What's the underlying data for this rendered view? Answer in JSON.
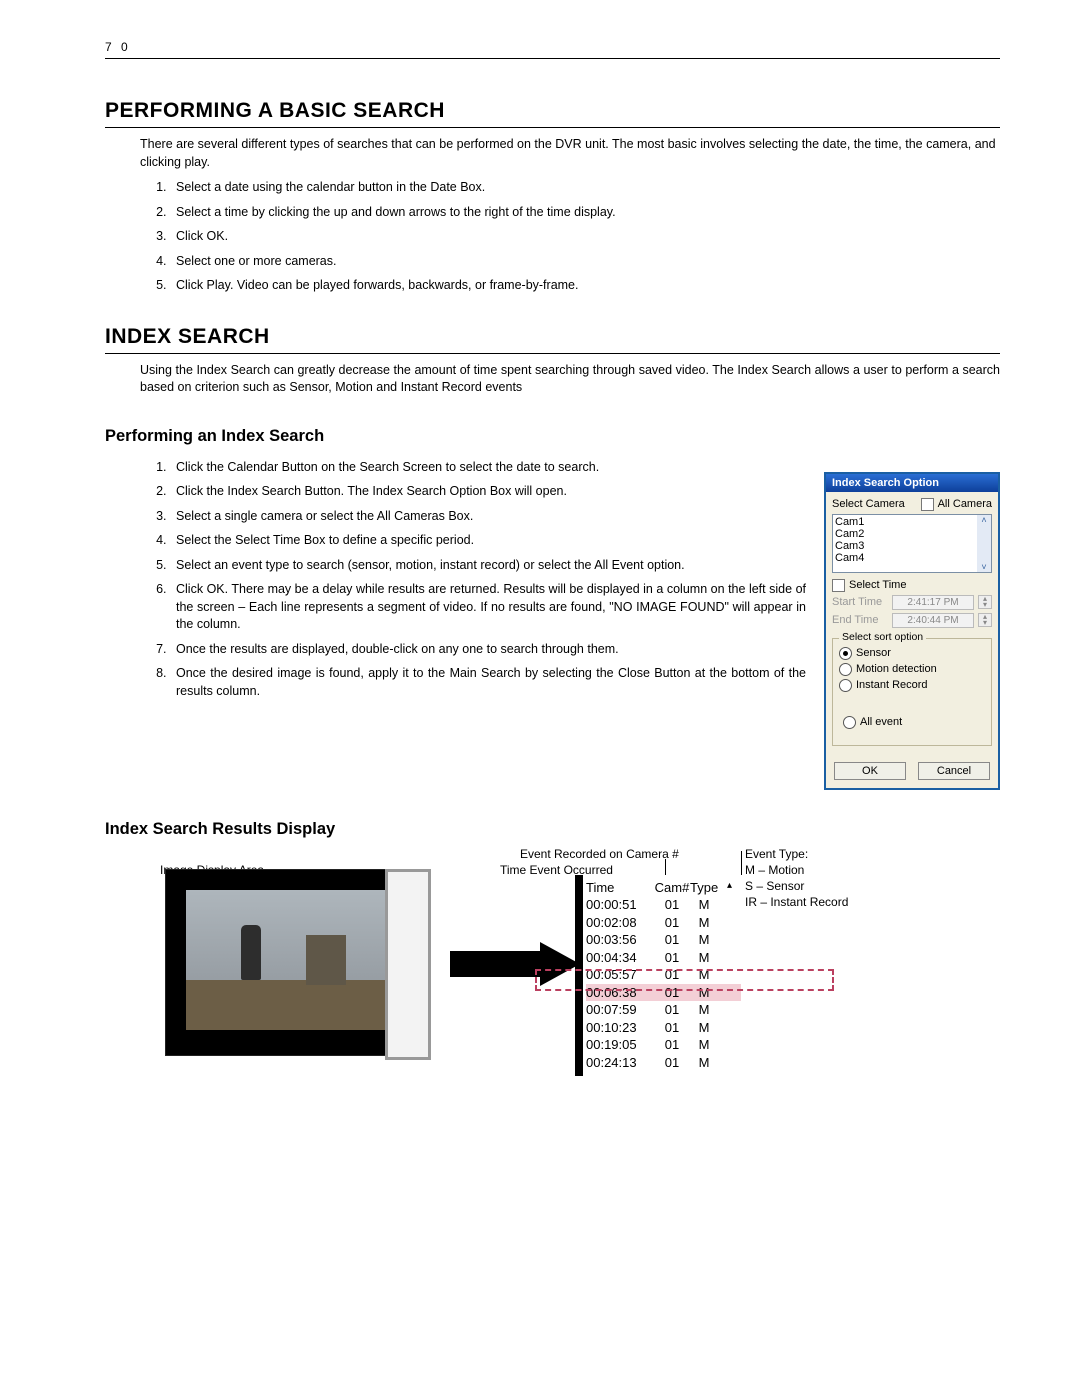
{
  "page_number": "7 0",
  "h1_basic": "PERFORMING A BASIC SEARCH",
  "basic_intro": "There are several different types of searches that can be performed on the DVR unit. The most basic involves selecting the date, the time, the camera, and clicking play.",
  "basic_steps": [
    "Select a date using the calendar button in the Date Box.",
    "Select a time by clicking the up and down arrows to the right of the time display.",
    "Click OK.",
    "Select one or more cameras.",
    "Click Play.  Video can be played forwards, backwards, or frame-by-frame."
  ],
  "h1_index": "INDEX SEARCH",
  "index_intro": "Using the Index Search can greatly decrease the amount of time spent searching through saved video. The Index Search allows a user to perform a search based on criterion such as Sensor, Motion and Instant Record events",
  "h2_perform": "Performing an Index Search",
  "index_steps": [
    "Click the Calendar Button on the Search Screen to select the date to search.",
    "Click the Index Search Button.  The Index Search Option Box will open.",
    "Select a single camera or select the All Cameras Box.",
    "Select the Select Time Box to define a specific period.",
    "Select an event type to search (sensor, motion, instant record) or select the All Event option.",
    "Click OK.  There may be a delay while results are returned.  Results will be displayed in a column on the left side of the screen – Each line represents a segment of video.  If no results are found, \"NO IMAGE FOUND\" will appear in the column.",
    "Once the results are displayed, double-click on any one to search through them.",
    "Once the desired image is found, apply it to the Main Search by selecting the Close Button at the bottom of the results column."
  ],
  "dialog": {
    "title": "Index Search Option",
    "select_camera": "Select Camera",
    "all_camera": "All Camera",
    "cams": [
      "Cam1",
      "Cam2",
      "Cam3",
      "Cam4"
    ],
    "select_time": "Select Time",
    "start_time": "Start Time",
    "start_time_val": "2:41:17 PM",
    "end_time": "End Time",
    "end_time_val": "2:40:44 PM",
    "sort_title": "Select sort option",
    "sort_sensor": "Sensor",
    "sort_motion": "Motion detection",
    "sort_instant": "Instant Record",
    "all_event": "All event",
    "ok": "OK",
    "cancel": "Cancel"
  },
  "h2_results": "Index Search Results Display",
  "labels": {
    "image_area": "Image Display Area",
    "event_cam": "Event Recorded on Camera #",
    "time_occ": "Time Event Occurred",
    "event_type_hdr": "Event Type:",
    "event_type_m": "M – Motion",
    "event_type_s": "S – Sensor",
    "event_type_ir": "IR – Instant Record"
  },
  "result_table": {
    "headers": {
      "time": "Time",
      "cam": "Cam#",
      "type": "Type"
    },
    "rows": [
      {
        "time": "00:00:51",
        "cam": "01",
        "type": "M"
      },
      {
        "time": "00:02:08",
        "cam": "01",
        "type": "M"
      },
      {
        "time": "00:03:56",
        "cam": "01",
        "type": "M"
      },
      {
        "time": "00:04:34",
        "cam": "01",
        "type": "M"
      },
      {
        "time": "00:05:57",
        "cam": "01",
        "type": "M"
      },
      {
        "time": "00:06:38",
        "cam": "01",
        "type": "M"
      },
      {
        "time": "00:07:59",
        "cam": "01",
        "type": "M"
      },
      {
        "time": "00:10:23",
        "cam": "01",
        "type": "M"
      },
      {
        "time": "00:19:05",
        "cam": "01",
        "type": "M"
      },
      {
        "time": "00:24:13",
        "cam": "01",
        "type": "M"
      }
    ],
    "highlight_index": 5
  }
}
